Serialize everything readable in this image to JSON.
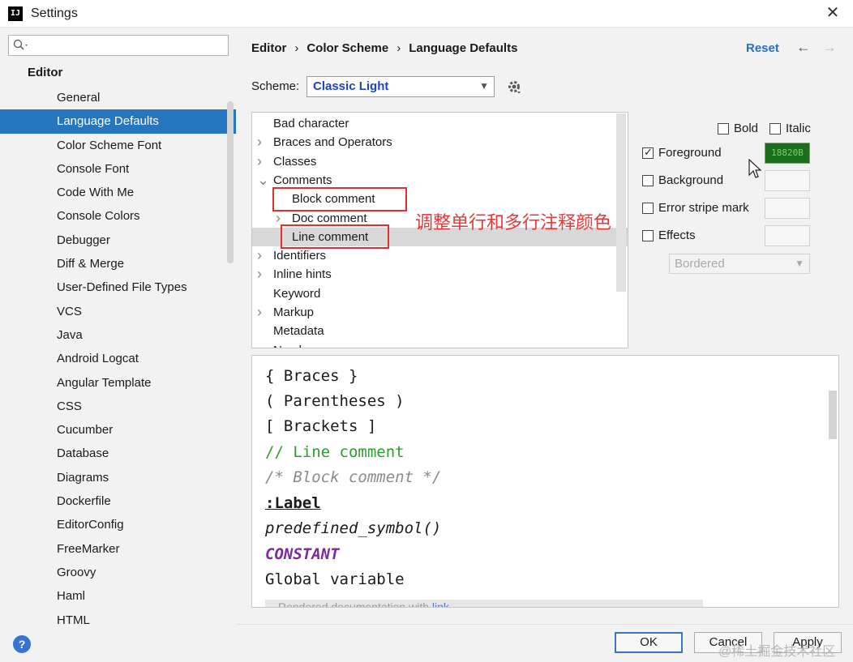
{
  "window": {
    "title": "Settings",
    "app_icon_text": "IJ"
  },
  "search": {
    "placeholder": ""
  },
  "sidebar": {
    "root": "Editor",
    "items": [
      "General",
      "Language Defaults",
      "Color Scheme Font",
      "Console Font",
      "Code With Me",
      "Console Colors",
      "Debugger",
      "Diff & Merge",
      "User-Defined File Types",
      "VCS",
      "Java",
      "Android Logcat",
      "Angular Template",
      "CSS",
      "Cucumber",
      "Database",
      "Diagrams",
      "Dockerfile",
      "EditorConfig",
      "FreeMarker",
      "Groovy",
      "Haml",
      "HTML"
    ],
    "selected_index": 1
  },
  "breadcrumb": {
    "items": [
      "Editor",
      "Color Scheme",
      "Language Defaults"
    ],
    "separator": "›"
  },
  "header": {
    "reset_label": "Reset",
    "back_arrow": "←",
    "forward_arrow": "→"
  },
  "scheme": {
    "label": "Scheme:",
    "value": "Classic Light"
  },
  "element_tree": {
    "rows": [
      {
        "label": "Bad character",
        "arrow": ""
      },
      {
        "label": "Braces and Operators",
        "arrow": ">"
      },
      {
        "label": "Classes",
        "arrow": ">"
      },
      {
        "label": "Comments",
        "arrow": "v"
      },
      {
        "label": "Block comment",
        "arrow": ""
      },
      {
        "label": "Doc comment",
        "arrow": ">"
      },
      {
        "label": "Line comment",
        "arrow": ""
      },
      {
        "label": "Identifiers",
        "arrow": ">"
      },
      {
        "label": "Inline hints",
        "arrow": ">"
      },
      {
        "label": "Keyword",
        "arrow": ""
      },
      {
        "label": "Markup",
        "arrow": ">"
      },
      {
        "label": "Metadata",
        "arrow": ""
      },
      {
        "label": "Numbers",
        "arrow": ""
      }
    ],
    "selected_index": 6
  },
  "annotation": {
    "text": "调整单行和多行注释颜色",
    "color": "#e23a3a"
  },
  "options": {
    "bold": {
      "label": "Bold",
      "checked": false
    },
    "italic": {
      "label": "Italic",
      "checked": false
    },
    "foreground": {
      "label": "Foreground",
      "checked": true,
      "value": "18820B"
    },
    "background": {
      "label": "Background",
      "checked": false
    },
    "error_stripe": {
      "label": "Error stripe mark",
      "checked": false
    },
    "effects": {
      "label": "Effects",
      "checked": false,
      "style": "Bordered"
    }
  },
  "preview": {
    "lines": {
      "braces": "{ Braces }",
      "parens": "( Parentheses )",
      "brackets": "[ Brackets ]",
      "line_comment": "// Line comment",
      "block_comment": "/* Block comment */",
      "label": ":Label",
      "predefined": "predefined_symbol()",
      "constant": "CONSTANT",
      "global": "Global variable"
    },
    "doc_text": "Rendered documentation with",
    "doc_link": "link",
    "colors": {
      "line_comment": "#2e9c2e",
      "block_comment": "#8a8a8a",
      "constant": "#7c2a9c"
    }
  },
  "footer": {
    "ok": "OK",
    "cancel": "Cancel",
    "apply": "Apply",
    "help": "?"
  },
  "watermark": "@稀土掘金技术社区",
  "colors": {
    "selection": "#2675bf",
    "link": "#2470c7",
    "scheme_value": "#1e44c4",
    "foreground_swatch": "#1a6e1e"
  }
}
